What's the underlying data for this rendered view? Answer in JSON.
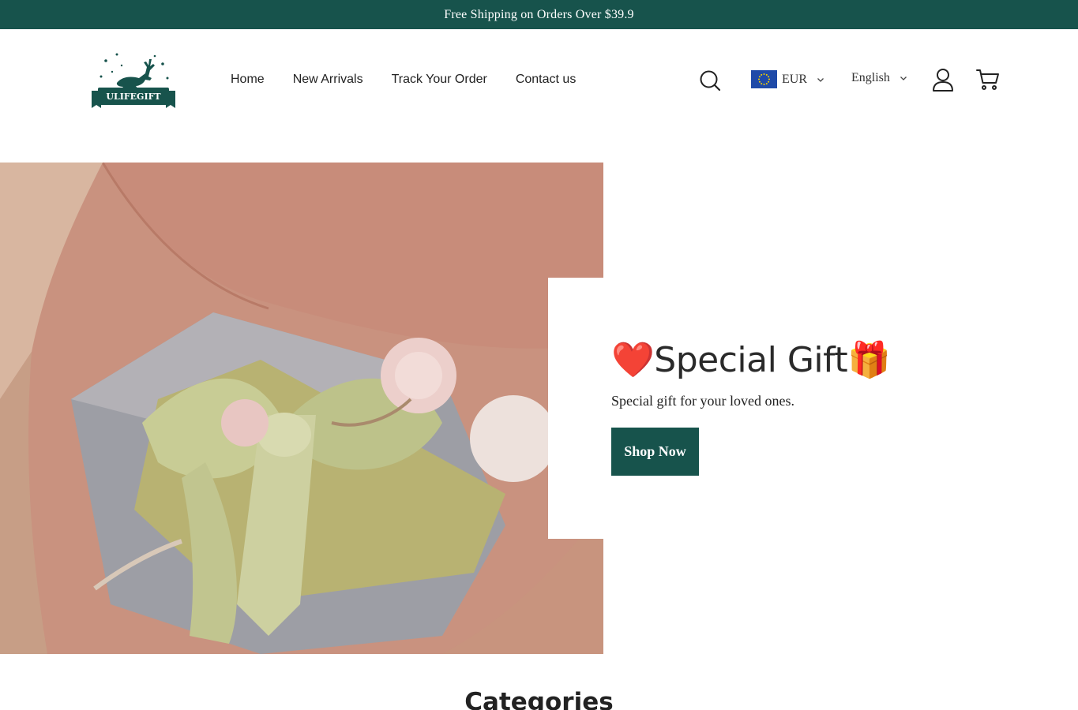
{
  "announcement": "Free Shipping on Orders Over $39.9",
  "brand": {
    "name": "ULIFEGIFT",
    "color": "#17534c"
  },
  "nav": {
    "items": [
      "Home",
      "New Arrivals",
      "Track Your Order",
      "Contact us"
    ]
  },
  "header": {
    "currency": "EUR",
    "currency_flag": "eu-flag-icon",
    "language": "English",
    "icons": [
      "search-icon",
      "user-icon",
      "cart-icon"
    ]
  },
  "hero": {
    "title_prefix": "❤️",
    "title": "Special Gift",
    "title_suffix": "🎁",
    "subtitle": "Special gift for your loved ones.",
    "button": "Shop Now"
  },
  "sections": {
    "categories_title": "Categories"
  }
}
